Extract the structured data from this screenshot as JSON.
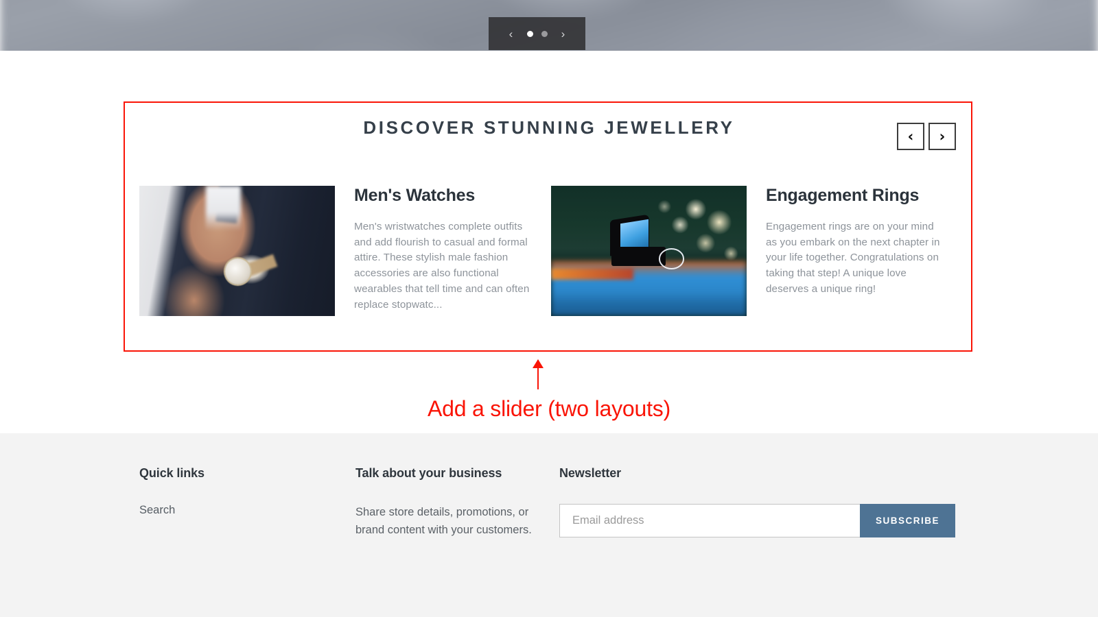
{
  "hero": {
    "prev_label": "‹",
    "next_label": "›",
    "dots": [
      {
        "label": "slide-1",
        "active": true
      },
      {
        "label": "slide-2",
        "active": false
      }
    ]
  },
  "slider": {
    "title": "DISCOVER STUNNING JEWELLERY",
    "prev_label": "‹",
    "next_label": "›",
    "cards": [
      {
        "title": "Men's Watches",
        "description": "Men's wristwatches complete outfits and add flourish to casual and formal attire. These stylish male fashion accessories are also functional wearables that tell time and can often replace stopwatc...",
        "image_alt": "man-in-suit-adjusting-tie-wearing-watch"
      },
      {
        "title": "Engagement Rings",
        "description": "Engagement rings are on your mind as you embark on the next chapter in your life together. Congratulations on taking that step! A unique love deserves a unique ring!",
        "image_alt": "engagement-ring-in-open-box-with-bokeh-lights"
      }
    ]
  },
  "annotation": {
    "label": "Add a slider (two layouts)",
    "color": "#fa1406"
  },
  "footer": {
    "quick_links": {
      "heading": "Quick links",
      "items": [
        {
          "label": "Search"
        }
      ]
    },
    "business": {
      "heading": "Talk about your business",
      "text": "Share store details, promotions, or brand content with your customers."
    },
    "newsletter": {
      "heading": "Newsletter",
      "placeholder": "Email address",
      "value": "",
      "button_label": "SUBSCRIBE",
      "button_color": "#4e7394"
    }
  }
}
